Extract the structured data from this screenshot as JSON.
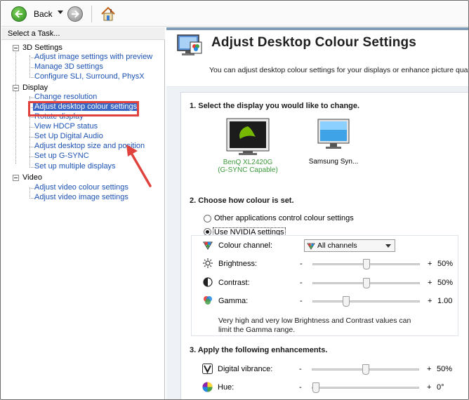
{
  "toolbar": {
    "back_label": "Back",
    "icons": [
      "back-arrow-icon",
      "dropdown-caret-icon",
      "forward-arrow-icon",
      "home-icon"
    ]
  },
  "sidebar": {
    "header": "Select a Task...",
    "categories": [
      {
        "label": "3D Settings",
        "items": [
          "Adjust image settings with preview",
          "Manage 3D settings",
          "Configure SLI, Surround, PhysX"
        ]
      },
      {
        "label": "Display",
        "items": [
          "Change resolution",
          "Adjust desktop colour settings",
          "Rotate display",
          "View HDCP status",
          "Set Up Digital Audio",
          "Adjust desktop size and position",
          "Set up G-SYNC",
          "Set up multiple displays"
        ]
      },
      {
        "label": "Video",
        "items": [
          "Adjust video colour settings",
          "Adjust video image settings"
        ]
      }
    ],
    "selected_item": "Adjust desktop colour settings"
  },
  "page": {
    "title": "Adjust Desktop Colour Settings",
    "description": "You can adjust desktop colour settings for your displays or enhance picture quality if"
  },
  "section1": {
    "title": "1. Select the display you would like to change.",
    "displays": [
      {
        "name_line1": "BenQ XL2420G",
        "name_line2": "(G-SYNC Capable)",
        "selected": true
      },
      {
        "name_line1": "Samsung Syn...",
        "name_line2": "",
        "selected": false
      }
    ]
  },
  "section2": {
    "title": "2. Choose how colour is set.",
    "option_other": "Other applications control colour settings",
    "option_nvidia": "Use NVIDIA settings",
    "selected_option": "Use NVIDIA settings",
    "colour_channel_label": "Colour channel:",
    "colour_channel_value": "All channels",
    "minus": "-",
    "plus": "+",
    "brightness": {
      "label": "Brightness:",
      "value": "50%",
      "level": 0.5
    },
    "contrast": {
      "label": "Contrast:",
      "value": "50%",
      "level": 0.5
    },
    "gamma": {
      "label": "Gamma:",
      "value": "1.00",
      "level": 0.3
    },
    "note": "Very high and very low Brightness and Contrast values can limit the Gamma range."
  },
  "section3": {
    "title": "3. Apply the following enhancements.",
    "digital_vibrance": {
      "label": "Digital vibrance:",
      "value": "50%",
      "level": 0.5
    },
    "hue": {
      "label": "Hue:",
      "value": "0°",
      "level": 0.0
    }
  },
  "colors": {
    "link": "#1c52b3",
    "selection": "#3a66c4",
    "highlight_annotation": "#e0433e",
    "nvidia_green": "#76b900"
  }
}
